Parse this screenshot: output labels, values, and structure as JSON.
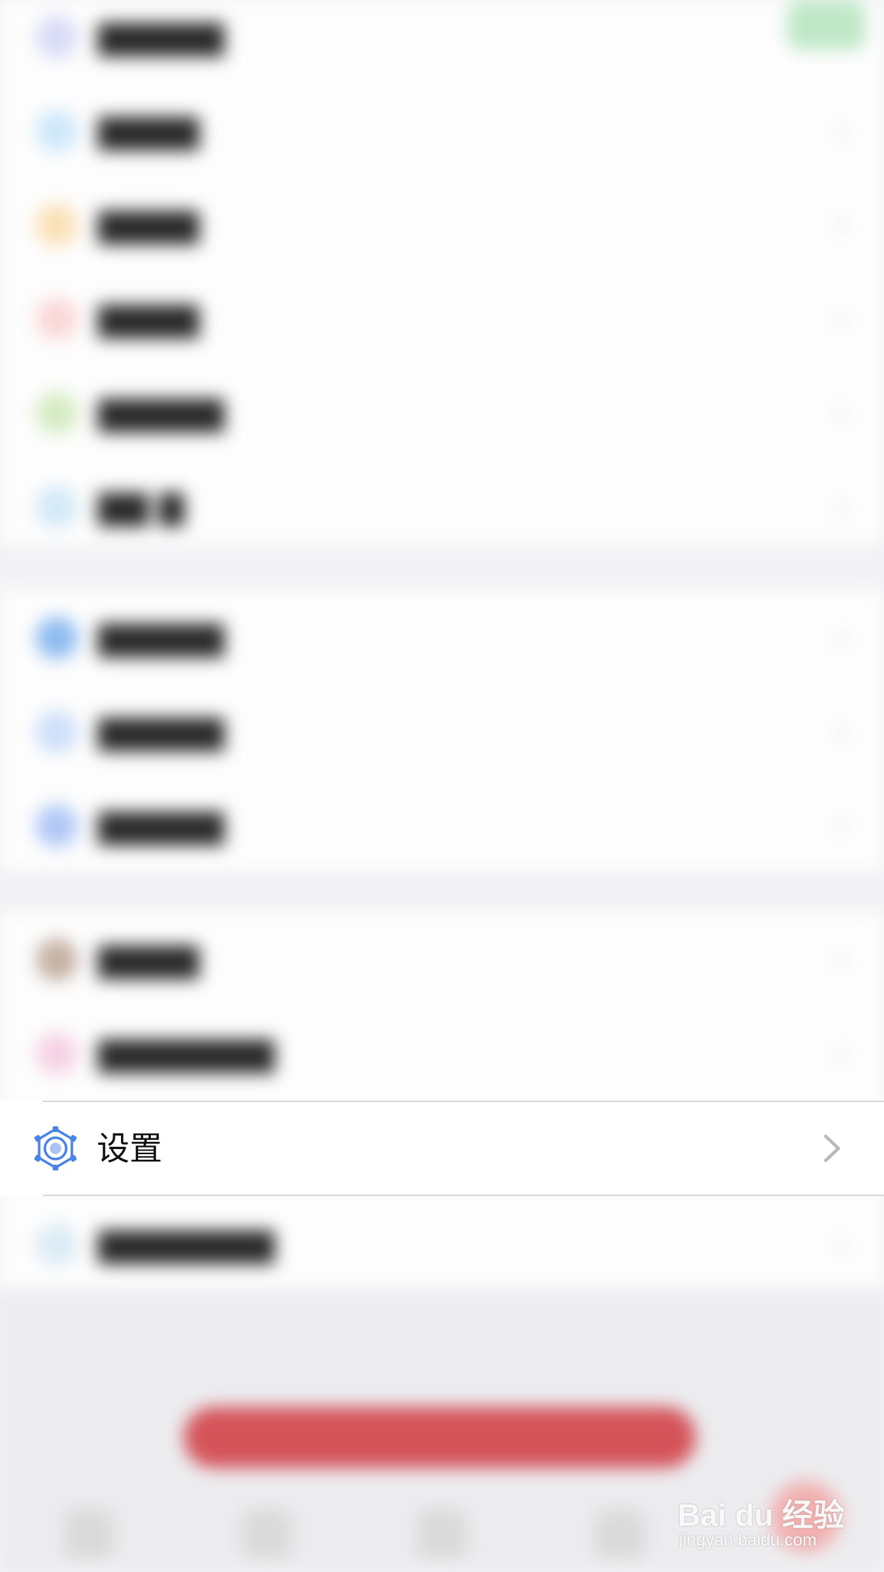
{
  "settings_row": {
    "label": "设置",
    "icon": "gear-icon",
    "chevron": "chevron-right-icon"
  },
  "colors": {
    "accent_blue": "#4a83e6",
    "primary_red": "#d4545a",
    "divider": "#d7d7d9"
  },
  "watermark": {
    "logo": "Bai du 经验",
    "url": "jingyan.baidu.com"
  }
}
